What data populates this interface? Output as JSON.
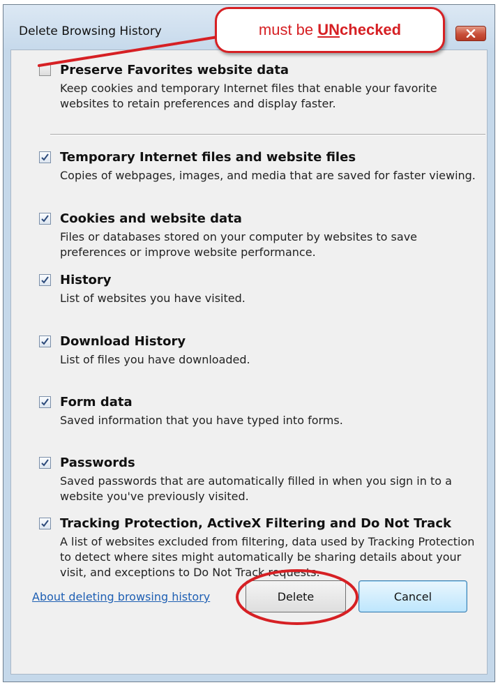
{
  "window": {
    "title": "Delete Browsing History",
    "close_icon": "close-icon"
  },
  "callout": {
    "prefix": "must be ",
    "emphasis": "UN",
    "suffix": "checked"
  },
  "options": [
    {
      "label": "Preserve Favorites website data",
      "checked": false,
      "description": "Keep cookies and temporary Internet files that enable your favorite websites to retain preferences and display faster."
    },
    {
      "label": "Temporary Internet files and website files",
      "checked": true,
      "description": "Copies of webpages, images, and media that are saved for faster viewing."
    },
    {
      "label": "Cookies and website data",
      "checked": true,
      "description": "Files or databases stored on your computer by websites to save preferences or improve website performance."
    },
    {
      "label": "History",
      "checked": true,
      "description": "List of websites you have visited."
    },
    {
      "label": "Download History",
      "checked": true,
      "description": "List of files you have downloaded."
    },
    {
      "label": "Form data",
      "checked": true,
      "description": "Saved information that you have typed into forms."
    },
    {
      "label": "Passwords",
      "checked": true,
      "description": "Saved passwords that are automatically filled in when you sign in to a website you've previously visited."
    },
    {
      "label": "Tracking Protection, ActiveX Filtering and Do Not Track",
      "checked": true,
      "description": "A list of websites excluded from filtering, data used by Tracking Protection to detect where sites might automatically be sharing details about your visit, and exceptions to Do Not Track requests."
    }
  ],
  "footer": {
    "link": "About deleting browsing history",
    "delete_label": "Delete",
    "cancel_label": "Cancel"
  },
  "colors": {
    "annotation": "#d62024",
    "link": "#1e5fb3",
    "checkmark": "#2c4a7a"
  }
}
